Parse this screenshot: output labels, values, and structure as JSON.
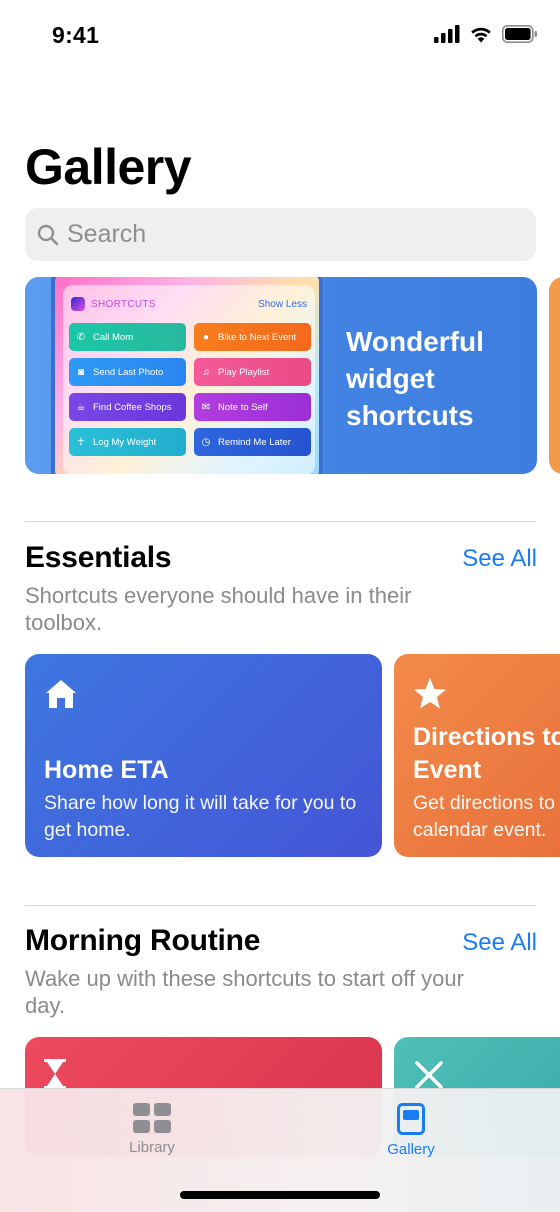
{
  "status_bar": {
    "time": "9:41"
  },
  "page_title": "Gallery",
  "search": {
    "placeholder": "Search"
  },
  "hero": {
    "title": "Wonderful widget shortcuts",
    "widget": {
      "app_label": "SHORTCUTS",
      "toggle_label": "Show Less",
      "actions": [
        {
          "label": "Call Mom",
          "icon": "phone-icon",
          "color": "#1bc7a8"
        },
        {
          "label": "Bike to Next Event",
          "icon": "location-pin-icon",
          "color": "#f77e1e"
        },
        {
          "label": "Send Last Photo",
          "icon": "camera-icon",
          "color": "#2f9af4"
        },
        {
          "label": "Play Playlist",
          "icon": "music-note-icon",
          "color": "#f45a9a"
        },
        {
          "label": "Find Coffee Shops",
          "icon": "coffee-cup-icon",
          "color": "#7a47e6"
        },
        {
          "label": "Note to Self",
          "icon": "envelope-icon",
          "color": "#b33de0"
        },
        {
          "label": "Log My Weight",
          "icon": "person-icon",
          "color": "#2ac0d8"
        },
        {
          "label": "Remind Me Later",
          "icon": "clock-icon",
          "color": "#2e66df"
        }
      ]
    }
  },
  "essentials": {
    "title": "Essentials",
    "see_all": "See All",
    "subtitle": "Shortcuts everyone should have in their toolbox.",
    "cards": [
      {
        "title": "Home ETA",
        "description": "Share how long it will take for you to get home.",
        "icon": "house-icon",
        "color": "#3e77e0"
      },
      {
        "title_line1": "Directions to",
        "title_line2": "Event",
        "description_line1": "Get directions to",
        "description_line2": "calendar event.",
        "icon": "star-icon",
        "color": "#f28a4a"
      }
    ]
  },
  "morning_routine": {
    "title": "Morning Routine",
    "see_all": "See All",
    "subtitle": "Wake up with these shortcuts to start off your day.",
    "cards": [
      {
        "icon": "hourglass-icon",
        "color": "#ee4a5e"
      },
      {
        "icon": "fork-knife-icon",
        "color": "#4fc0b8"
      }
    ]
  },
  "tab_bar": {
    "tabs": [
      {
        "label": "Library",
        "icon": "grid-icon",
        "active": false
      },
      {
        "label": "Gallery",
        "icon": "gallery-icon",
        "active": true
      }
    ],
    "active_color": "#1a7cf5",
    "inactive_color": "#8e8e93"
  }
}
